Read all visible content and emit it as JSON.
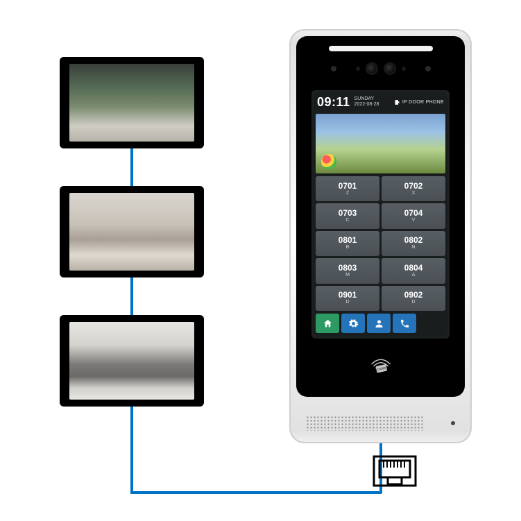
{
  "colors": {
    "line": "#0073c8",
    "tool_green": "#2e9a63",
    "tool_blue": "#2573b8"
  },
  "monitors": [
    {
      "name": "indoor-monitor-lobby"
    },
    {
      "name": "indoor-monitor-living-room"
    },
    {
      "name": "indoor-monitor-lounge"
    }
  ],
  "door_phone": {
    "status": {
      "time": "09:11",
      "date_line1": "SUNDAY",
      "date_line2": "2022-08-28",
      "right_label": "IP DOOR PHONE"
    },
    "units": [
      {
        "num": "0701",
        "sub": "Z"
      },
      {
        "num": "0702",
        "sub": "X"
      },
      {
        "num": "0703",
        "sub": "C"
      },
      {
        "num": "0704",
        "sub": "V"
      },
      {
        "num": "0801",
        "sub": "B"
      },
      {
        "num": "0802",
        "sub": "N"
      },
      {
        "num": "0803",
        "sub": "M"
      },
      {
        "num": "0804",
        "sub": "A"
      },
      {
        "num": "0901",
        "sub": "D"
      },
      {
        "num": "0902",
        "sub": "D"
      }
    ],
    "toolbar": [
      {
        "name": "home-button",
        "color": "green",
        "icon": "home"
      },
      {
        "name": "settings-button",
        "color": "blue",
        "icon": "gear"
      },
      {
        "name": "contacts-button",
        "color": "blue",
        "icon": "person"
      },
      {
        "name": "call-button",
        "color": "blue",
        "icon": "phone"
      }
    ]
  },
  "ethernet": {
    "label": "ethernet-port"
  }
}
